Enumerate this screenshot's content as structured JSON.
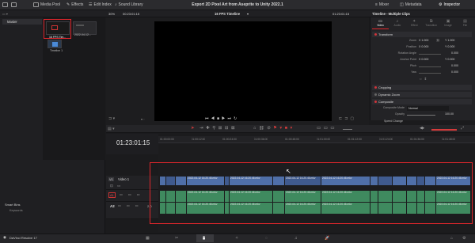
{
  "topbar": {
    "media_pool": "Media Pool",
    "effects": "Effects",
    "edit_index": "Edit Index",
    "sound_library": "Sound Library",
    "project_title": "Export 2D Pixel Art from Aseprite to Unity 2022.1",
    "mixer": "Mixer",
    "metadata": "Metadata",
    "inspector": "Inspector"
  },
  "viewerbar": {
    "zoom": "30%",
    "source_tc": "00:23:01:15",
    "timeline_name": "16 FPS Timeline",
    "record_tc": "01:23:01:15",
    "panel_title": "Timeline - Multiple Clips"
  },
  "bin": {
    "master": "Master",
    "smart_bins": "Smart Bins",
    "keywords": "Keywords"
  },
  "media": [
    {
      "label": "16 FPS Tim..."
    },
    {
      "label": "2022-04-12..."
    },
    {
      "label": "Timeline 1"
    }
  ],
  "inspector": {
    "tabs": [
      "Video",
      "Audio",
      "Effect",
      "Transition",
      "Image",
      "File"
    ],
    "transform": "Transform",
    "rows": [
      {
        "label": "Zoom",
        "x": "X  1.000",
        "y": "Y  1.000"
      },
      {
        "label": "Position",
        "x": "X  0.000",
        "y": "Y  0.000"
      },
      {
        "label": "Rotation Angle",
        "x": "",
        "y": "0.000"
      },
      {
        "label": "Anchor Point",
        "x": "X  0.000",
        "y": "Y  0.000"
      },
      {
        "label": "Pitch",
        "x": "",
        "y": "0.000"
      },
      {
        "label": "Yaw",
        "x": "",
        "y": "0.000"
      }
    ],
    "cropping": "Cropping",
    "dynamic_zoom": "Dynamic Zoom",
    "composite": "Composite",
    "composite_mode_label": "Composite Mode",
    "composite_mode_value": "Normal",
    "opacity_label": "Opacity",
    "opacity_value": "100.00",
    "speed_change": "Speed Change"
  },
  "timeline": {
    "timecode": "01:23:01:15",
    "ruler": [
      "01:00:00:00",
      "01:00:12:00",
      "01:00:24:00",
      "01:00:36:00",
      "01:00:48:00",
      "01:01:00:00",
      "01:01:12:00",
      "01:01:24:00",
      "01:01:36:00",
      "01:01:48:00"
    ],
    "video_track": "Video 1",
    "v_badge": "V1",
    "a1_badge": "A1",
    "a2_label": "A2",
    "a2_value": "2.0",
    "video_clip_text": "2022-04-12 16.20.46.mkv",
    "audio_clip_text": "2022-04-12 16.20.46.mkv"
  },
  "pagebar": {
    "app_name": "DaVinci Resolve 17"
  }
}
